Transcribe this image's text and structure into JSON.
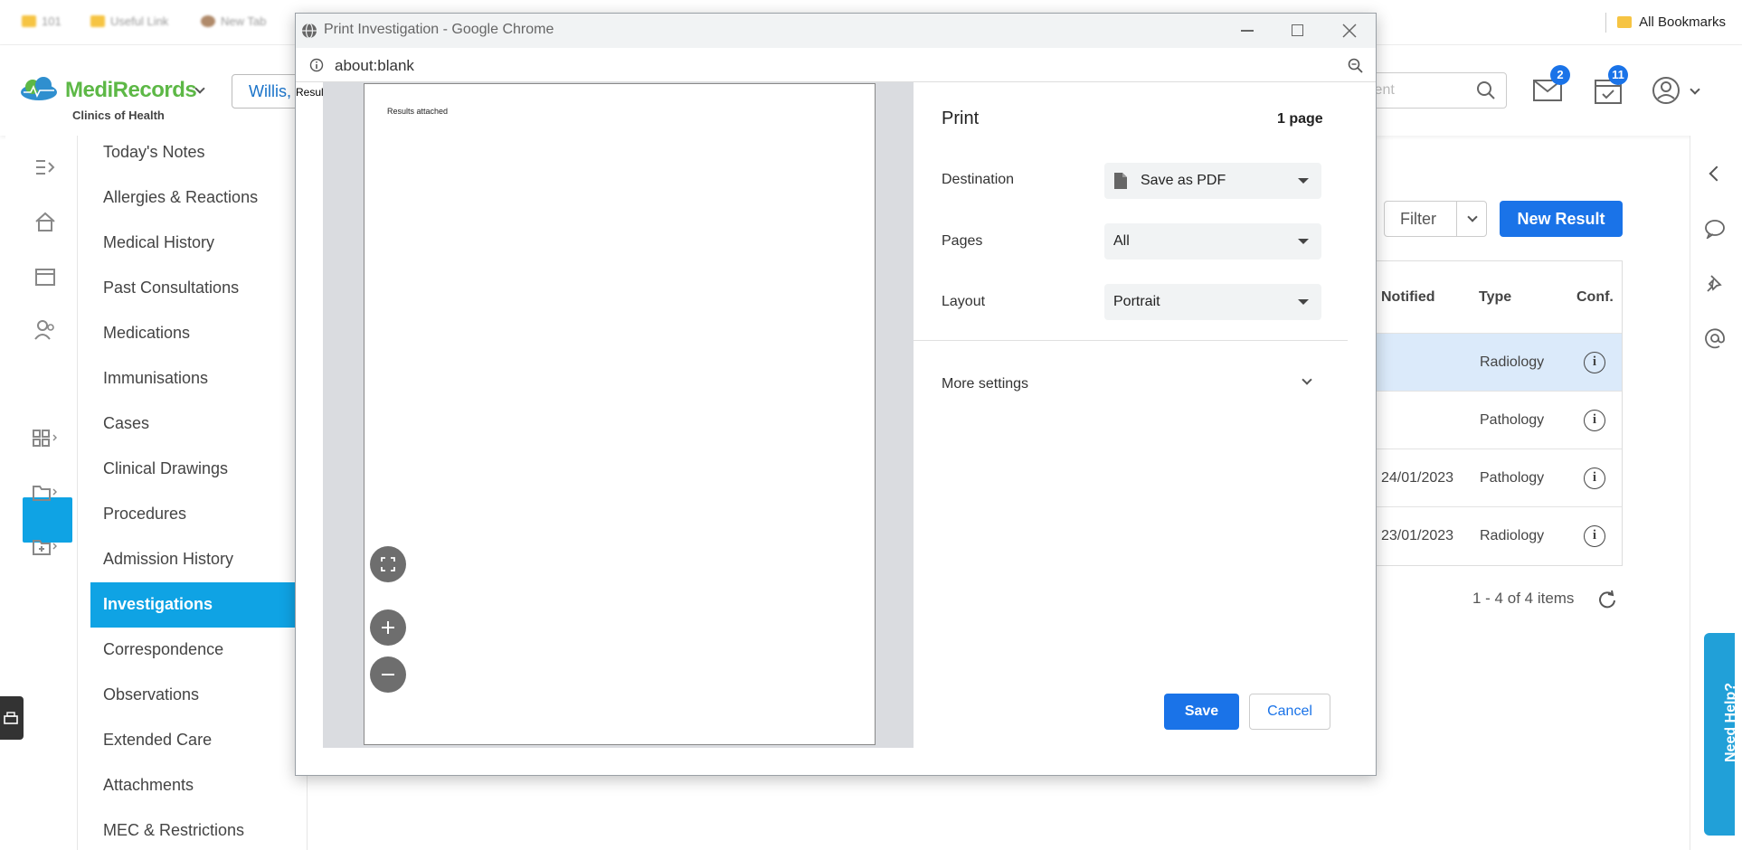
{
  "bookmarks_bar": {
    "items": [
      "101",
      "Useful Link",
      "New Tab"
    ],
    "all_bookmarks_label": "All Bookmarks"
  },
  "app": {
    "brand": "MediRecords",
    "clinic": "Clinics of Health",
    "patient_chip": "Willis,",
    "search_placeholder": "ient",
    "mail_count": "2",
    "tasks_count": "11",
    "colors": {
      "accent": "#0fa3e4",
      "primary_button": "#1a73e8",
      "brand_green": "#5db846"
    }
  },
  "nav": {
    "items": [
      "Today's Notes",
      "Allergies & Reactions",
      "Medical History",
      "Past Consultations",
      "Medications",
      "Immunisations",
      "Cases",
      "Clinical Drawings",
      "Procedures",
      "Admission History",
      "Investigations",
      "Correspondence",
      "Observations",
      "Extended Care",
      "Attachments",
      "MEC & Restrictions"
    ],
    "active": "Investigations"
  },
  "results": {
    "filter_label": "Filter",
    "new_result_label": "New Result",
    "columns": [
      "Notified",
      "Type",
      "Conf."
    ],
    "rows": [
      {
        "notified": "",
        "type": "Radiology",
        "selected": true
      },
      {
        "notified": "",
        "type": "Pathology",
        "selected": false
      },
      {
        "notified": "24/01/2023",
        "type": "Pathology",
        "selected": false
      },
      {
        "notified": "23/01/2023",
        "type": "Radiology",
        "selected": false
      }
    ],
    "pager_text": "1 - 4 of 4 items"
  },
  "need_help_label": "Need Help?",
  "print_dialog": {
    "window_title": "Print Investigation - Google Chrome",
    "url": "about:blank",
    "behind_text": "Resul",
    "page_text": "Results attached",
    "heading": "Print",
    "page_count": "1 page",
    "destination_label": "Destination",
    "destination_value": "Save as PDF",
    "pages_label": "Pages",
    "pages_value": "All",
    "layout_label": "Layout",
    "layout_value": "Portrait",
    "more_settings_label": "More settings",
    "save_label": "Save",
    "cancel_label": "Cancel"
  }
}
